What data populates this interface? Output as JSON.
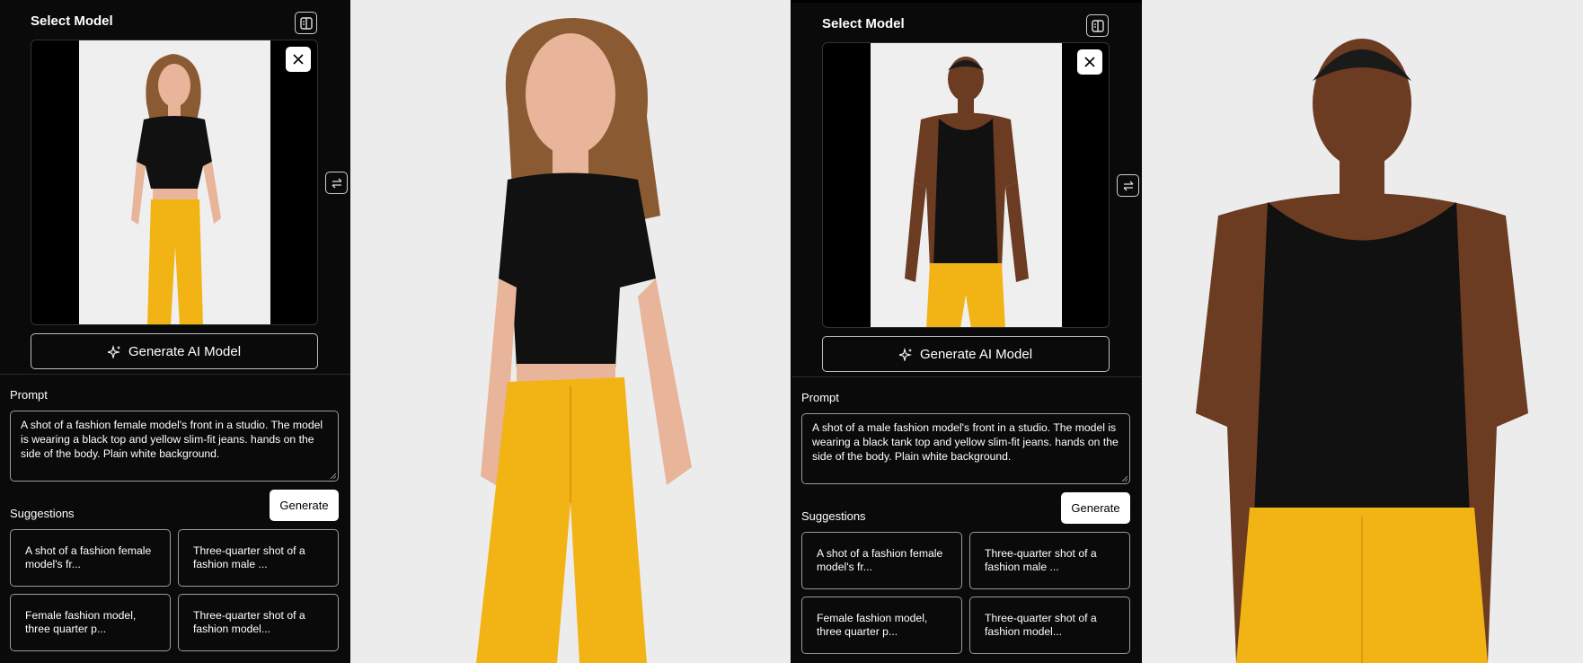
{
  "panels": [
    {
      "title": "Select Model",
      "generate_model_label": "Generate AI Model",
      "prompt_label": "Prompt",
      "prompt_text": "A shot of a fashion female model's front in a studio. The model is wearing a black top and yellow slim-fit jeans. hands on the side of the body. Plain white background.",
      "generate_label": "Generate",
      "suggestions_label": "Suggestions",
      "suggestions": [
        "A shot of a fashion female model's fr...",
        "Three-quarter shot of a fashion male ...",
        "Female fashion model, three quarter p...",
        "Three-quarter shot of a fashion model..."
      ]
    },
    {
      "title": "Select Model",
      "generate_model_label": "Generate AI Model",
      "prompt_label": "Prompt",
      "prompt_text": "A shot of a male fashion model's front in a studio. The model is wearing a black tank top and yellow slim-fit jeans. hands on the side of the body. Plain white background.",
      "generate_label": "Generate",
      "suggestions_label": "Suggestions",
      "suggestions": [
        "A shot of a fashion female model's fr...",
        "Three-quarter shot of a fashion male ...",
        "Female fashion model, three quarter p...",
        "Three-quarter shot of a fashion model..."
      ]
    }
  ],
  "colors": {
    "panel_bg": "#0a0a0a",
    "photo_bg": "#ececec",
    "top_black": "#111111",
    "jeans_yellow": "#f2b415",
    "skin_light": "#e8b49a",
    "skin_dark": "#6b3b22",
    "hair_light": "#8a5a32"
  },
  "icons": [
    "sidebar-toggle-icon",
    "close-icon",
    "swap-icon",
    "sparkle-icon"
  ]
}
